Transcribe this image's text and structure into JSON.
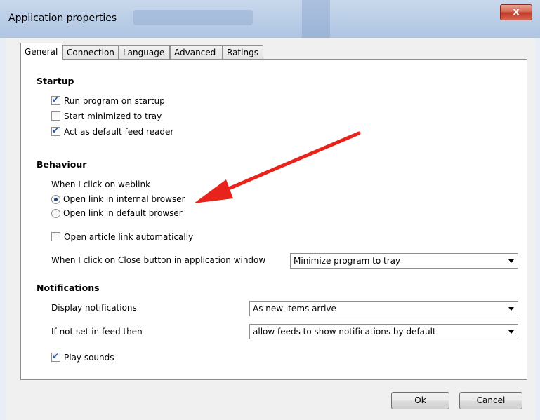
{
  "window": {
    "title": "Application properties",
    "close_glyph": "x"
  },
  "tabs": [
    {
      "label": "General",
      "active": true
    },
    {
      "label": "Connection",
      "active": false
    },
    {
      "label": "Language",
      "active": false
    },
    {
      "label": "Advanced",
      "active": false
    },
    {
      "label": "Ratings",
      "active": false
    }
  ],
  "startup": {
    "heading": "Startup",
    "options": [
      {
        "label": "Run program on startup",
        "checked": true
      },
      {
        "label": "Start minimized to tray",
        "checked": false
      },
      {
        "label": "Act as default feed reader",
        "checked": true
      }
    ]
  },
  "behaviour": {
    "heading": "Behaviour",
    "weblink_label": "When I click on weblink",
    "radios": [
      {
        "label": "Open link in internal browser",
        "selected": true
      },
      {
        "label": "Open link in default browser",
        "selected": false
      }
    ],
    "open_article": {
      "label": "Open article link automatically",
      "checked": false
    },
    "close_label": "When I click on Close button in application window",
    "close_value": "Minimize program to tray"
  },
  "notifications": {
    "heading": "Notifications",
    "display_label": "Display notifications",
    "display_value": "As new items arrive",
    "feed_label": "If not set in feed then",
    "feed_value": "allow feeds to show notifications by default",
    "play_sounds": {
      "label": "Play sounds",
      "checked": true
    }
  },
  "buttons": {
    "ok": "Ok",
    "cancel": "Cancel"
  },
  "annotation": {
    "arrow_color": "#e8231b",
    "icon": "red-arrow-annotation"
  }
}
